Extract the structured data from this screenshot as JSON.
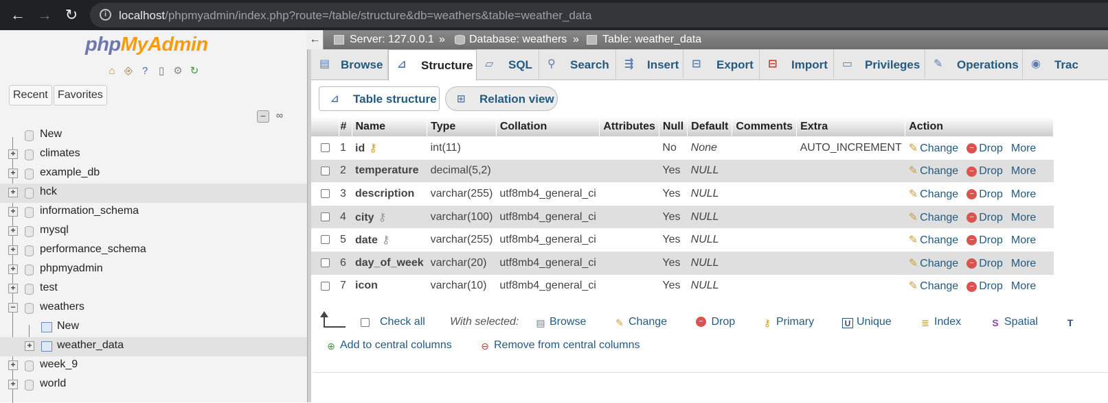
{
  "browser": {
    "url_host": "localhost",
    "url_path": "/phpmyadmin/index.php?route=/table/structure&db=weathers&table=weather_data"
  },
  "sidebar": {
    "logo_php": "php",
    "logo_my": "MyAdmin",
    "recent": "Recent",
    "favorites": "Favorites",
    "tree": [
      {
        "label": "New",
        "kind": "new"
      },
      {
        "label": "climates",
        "kind": "db"
      },
      {
        "label": "example_db",
        "kind": "db"
      },
      {
        "label": "hck",
        "kind": "db"
      },
      {
        "label": "information_schema",
        "kind": "db"
      },
      {
        "label": "mysql",
        "kind": "db"
      },
      {
        "label": "performance_schema",
        "kind": "db"
      },
      {
        "label": "phpmyadmin",
        "kind": "db"
      },
      {
        "label": "test",
        "kind": "db"
      },
      {
        "label": "weathers",
        "kind": "db-open"
      },
      {
        "label": "New",
        "kind": "new-sub"
      },
      {
        "label": "weather_data",
        "kind": "table"
      },
      {
        "label": "week_9",
        "kind": "db"
      },
      {
        "label": "world",
        "kind": "db"
      }
    ]
  },
  "breadcrumb": {
    "server": "Server: 127.0.0.1",
    "database": "Database: weathers",
    "table": "Table: weather_data",
    "sep": "»"
  },
  "tabs": [
    "Browse",
    "Structure",
    "SQL",
    "Search",
    "Insert",
    "Export",
    "Import",
    "Privileges",
    "Operations",
    "Trac"
  ],
  "subtabs": {
    "table_structure": "Table structure",
    "relation_view": "Relation view"
  },
  "table": {
    "headers": [
      "#",
      "Name",
      "Type",
      "Collation",
      "Attributes",
      "Null",
      "Default",
      "Comments",
      "Extra",
      "Action"
    ],
    "rows": [
      {
        "num": "1",
        "name": "id",
        "type": "int(11)",
        "collation": "",
        "attributes": "",
        "null": "No",
        "default": "None",
        "comments": "",
        "extra": "AUTO_INCREMENT",
        "key": "primary"
      },
      {
        "num": "2",
        "name": "temperature",
        "type": "decimal(5,2)",
        "collation": "",
        "attributes": "",
        "null": "Yes",
        "default": "NULL",
        "comments": "",
        "extra": "",
        "key": ""
      },
      {
        "num": "3",
        "name": "description",
        "type": "varchar(255)",
        "collation": "utf8mb4_general_ci",
        "attributes": "",
        "null": "Yes",
        "default": "NULL",
        "comments": "",
        "extra": "",
        "key": ""
      },
      {
        "num": "4",
        "name": "city",
        "type": "varchar(100)",
        "collation": "utf8mb4_general_ci",
        "attributes": "",
        "null": "Yes",
        "default": "NULL",
        "comments": "",
        "extra": "",
        "key": "index"
      },
      {
        "num": "5",
        "name": "date",
        "type": "varchar(255)",
        "collation": "utf8mb4_general_ci",
        "attributes": "",
        "null": "Yes",
        "default": "NULL",
        "comments": "",
        "extra": "",
        "key": "index"
      },
      {
        "num": "6",
        "name": "day_of_week",
        "type": "varchar(20)",
        "collation": "utf8mb4_general_ci",
        "attributes": "",
        "null": "Yes",
        "default": "NULL",
        "comments": "",
        "extra": "",
        "key": ""
      },
      {
        "num": "7",
        "name": "icon",
        "type": "varchar(10)",
        "collation": "utf8mb4_general_ci",
        "attributes": "",
        "null": "Yes",
        "default": "NULL",
        "comments": "",
        "extra": "",
        "key": ""
      }
    ],
    "actions": {
      "change": "Change",
      "drop": "Drop",
      "more": "More"
    }
  },
  "footer": {
    "check_all": "Check all",
    "with_selected": "With selected:",
    "browse": "Browse",
    "change": "Change",
    "drop": "Drop",
    "primary": "Primary",
    "unique": "Unique",
    "index": "Index",
    "spatial": "Spatial",
    "add_central": "Add to central columns",
    "remove_central": "Remove from central columns"
  },
  "colors": {
    "link": "#235a81",
    "accent_orange": "#f89c0e",
    "logo_blue": "#6c78af",
    "drop_red": "#d9534f"
  }
}
